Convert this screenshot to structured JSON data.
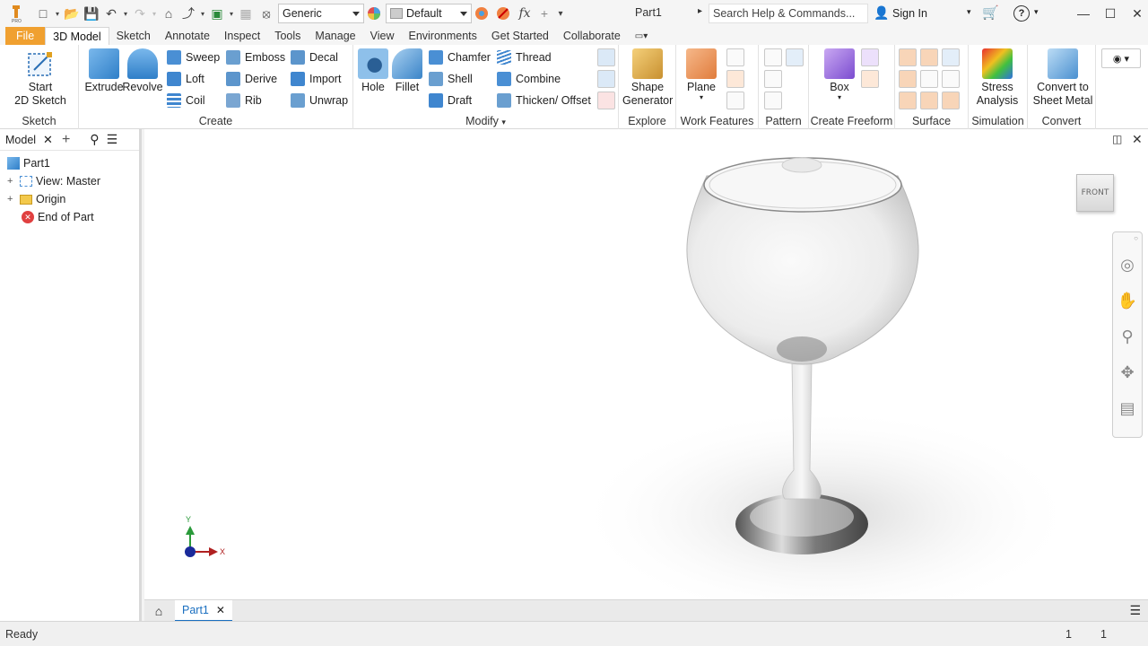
{
  "qat": {
    "material": "Generic",
    "appearance": "Default",
    "document_title": "Part1",
    "search_placeholder": "Search Help & Commands...",
    "sign_in": "Sign In"
  },
  "tabs": [
    "File",
    "3D Model",
    "Sketch",
    "Annotate",
    "Inspect",
    "Tools",
    "Manage",
    "View",
    "Environments",
    "Get Started",
    "Collaborate"
  ],
  "ribbon": {
    "sketch": {
      "title": "Sketch",
      "start_line1": "Start",
      "start_line2": "2D Sketch"
    },
    "create": {
      "title": "Create",
      "extrude": "Extrude",
      "revolve": "Revolve",
      "sweep": "Sweep",
      "loft": "Loft",
      "coil": "Coil",
      "emboss": "Emboss",
      "derive": "Derive",
      "rib": "Rib",
      "decal": "Decal",
      "import": "Import",
      "unwrap": "Unwrap"
    },
    "modify": {
      "title": "Modify",
      "hole": "Hole",
      "fillet": "Fillet",
      "chamfer": "Chamfer",
      "shell": "Shell",
      "draft": "Draft",
      "thread": "Thread",
      "combine": "Combine",
      "thicken": "Thicken/ Offset"
    },
    "explore": {
      "title": "Explore",
      "line1": "Shape",
      "line2": "Generator"
    },
    "work_features": {
      "title": "Work Features",
      "plane": "Plane"
    },
    "pattern": {
      "title": "Pattern"
    },
    "freeform": {
      "title": "Create Freeform",
      "box": "Box"
    },
    "surface": {
      "title": "Surface"
    },
    "simulation": {
      "title": "Simulation",
      "line1": "Stress",
      "line2": "Analysis"
    },
    "convert": {
      "title": "Convert",
      "line1": "Convert to",
      "line2": "Sheet Metal"
    }
  },
  "browser": {
    "tab": "Model",
    "items": [
      "Part1",
      "View: Master",
      "Origin",
      "End of Part"
    ]
  },
  "viewcube": {
    "face": "FRONT"
  },
  "triad": {
    "x": "X",
    "y": "Y"
  },
  "doc_tab": "Part1",
  "status": {
    "left": "Ready",
    "count1": "1",
    "count2": "1"
  },
  "colors": {
    "accent": "#f0a030",
    "active_blue": "#1a6fc0"
  }
}
